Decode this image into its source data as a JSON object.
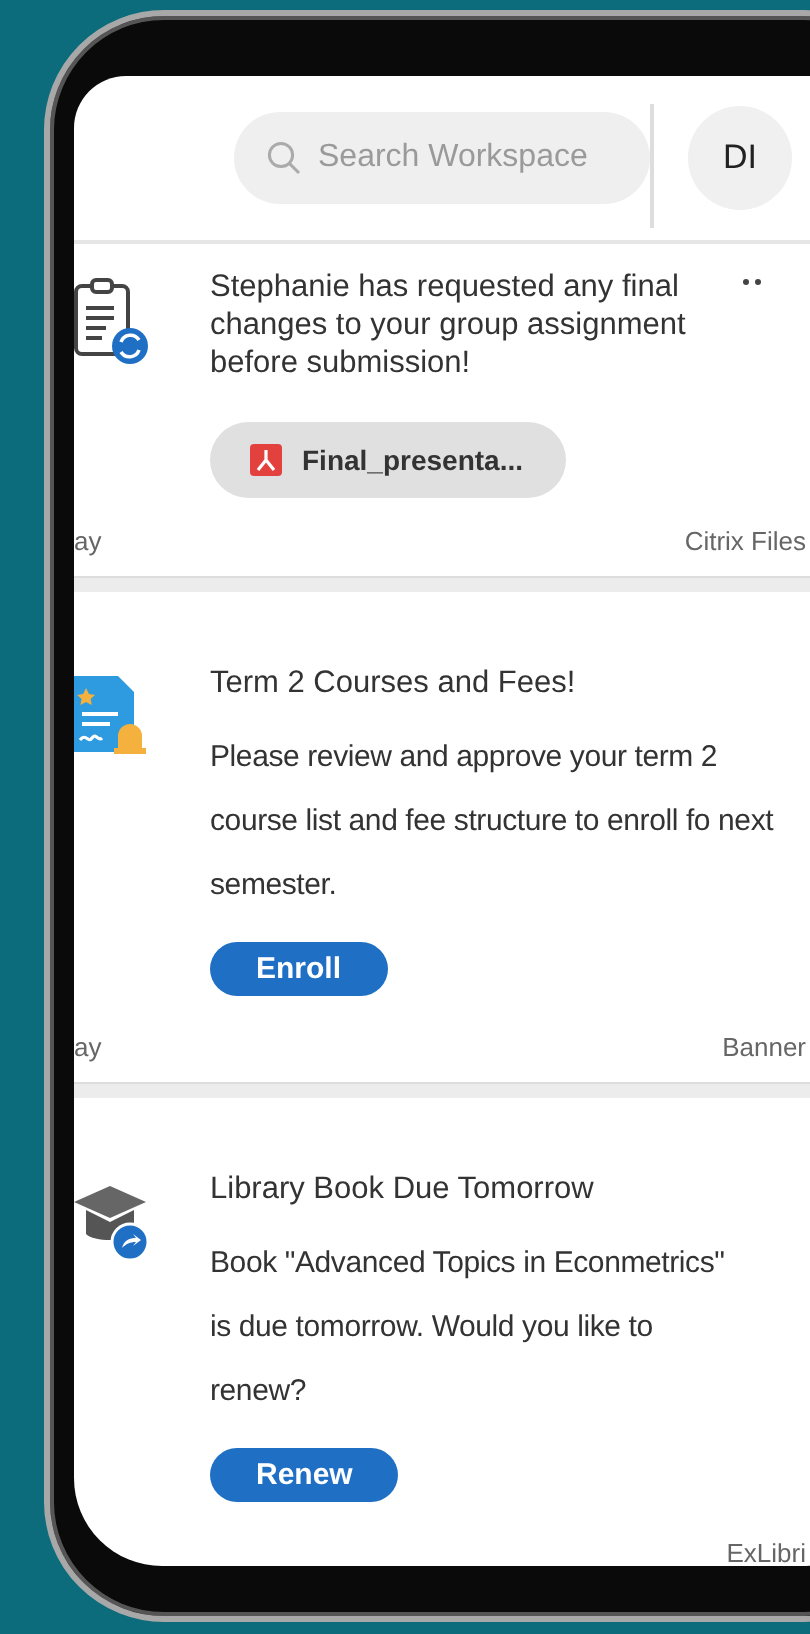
{
  "header": {
    "search": {
      "placeholder": "Search Workspace"
    },
    "avatar": "DI"
  },
  "cards": [
    {
      "kind": "attachment",
      "body": "Stephanie has requested any final changes to your group assignment before submission!",
      "attachment": "Final_presenta...",
      "time": "ay",
      "source": "Citrix Files"
    },
    {
      "kind": "action",
      "title": "Term 2 Courses and Fees!",
      "body": "Please review and approve your term 2 course list and fee structure to enroll fo next semester.",
      "action": "Enroll",
      "time": "ay",
      "source": "Banner"
    },
    {
      "kind": "action",
      "title": "Library Book Due Tomorrow",
      "body": "Book \"Advanced Topics in Econmetrics\" is due tomorrow. Would you like to renew?",
      "action": "Renew",
      "source": "ExLibri"
    }
  ]
}
